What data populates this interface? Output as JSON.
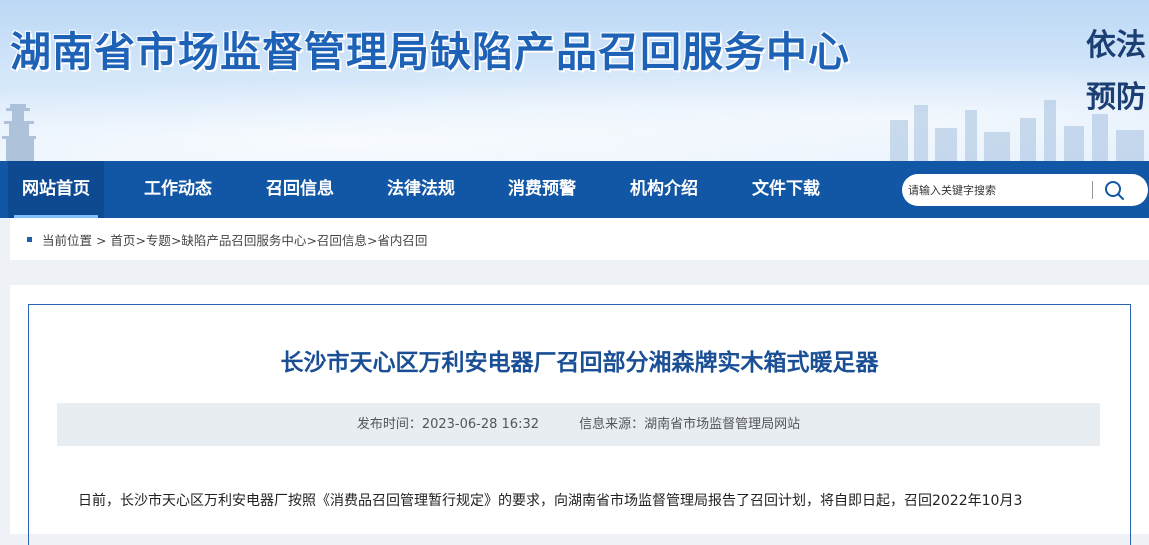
{
  "header": {
    "site_title": "湖南省市场监督管理局缺陷产品召回服务中心",
    "slogan_line1": "依法",
    "slogan_line2": "预防"
  },
  "nav": {
    "items": [
      {
        "label": "网站首页",
        "active": true
      },
      {
        "label": "工作动态",
        "active": false
      },
      {
        "label": "召回信息",
        "active": false
      },
      {
        "label": "法律法规",
        "active": false
      },
      {
        "label": "消费预警",
        "active": false
      },
      {
        "label": "机构介绍",
        "active": false
      },
      {
        "label": "文件下载",
        "active": false
      }
    ]
  },
  "search": {
    "placeholder": "请输入关键字搜索",
    "icon": "search-icon"
  },
  "breadcrumb": {
    "prefix": "当前位置 > ",
    "items": [
      "首页",
      "专题",
      "缺陷产品召回服务中心",
      "召回信息",
      "省内召回"
    ],
    "separator": ">"
  },
  "article": {
    "title": "长沙市天心区万利安电器厂召回部分湘森牌实木箱式暖足器",
    "publish_time": "发布时间：2023-06-28 16:32",
    "source": "信息来源：湖南省市场监督管理局网站",
    "first_line": "日前，长沙市天心区万利安电器厂按照《消费品召回管理暂行规定》的要求，向湖南省市场监督管理局报告了召回计划，将自即日起，召回2022年10月3"
  },
  "colors": {
    "nav_bg": "#1257a5",
    "title_blue": "#1d62b7",
    "article_title": "#1a4f96",
    "frame_border": "#2b64b1"
  }
}
